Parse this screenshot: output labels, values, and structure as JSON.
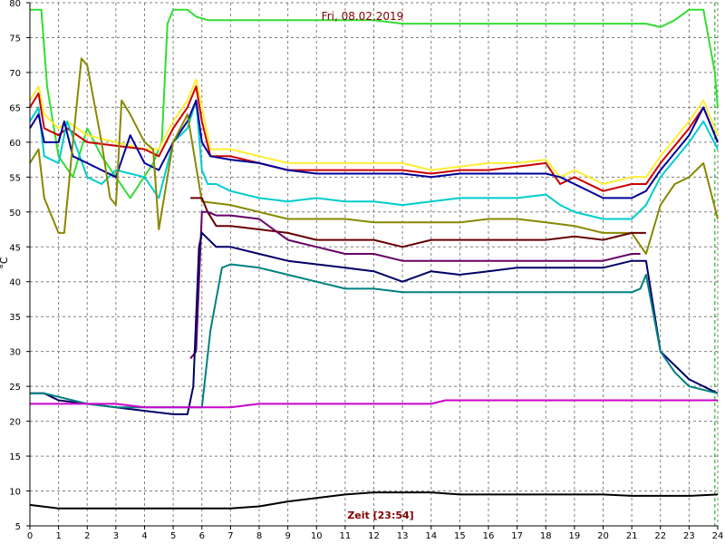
{
  "chart_data": {
    "type": "line",
    "title": "Fri, 08.02.2019",
    "xlabel": "Zeit [23:54]",
    "ylabel": "°C",
    "xlim": [
      0,
      24
    ],
    "ylim": [
      5,
      80
    ],
    "x_ticks": [
      0,
      1,
      2,
      3,
      4,
      5,
      6,
      7,
      8,
      9,
      10,
      11,
      12,
      13,
      14,
      15,
      16,
      17,
      18,
      19,
      20,
      21,
      22,
      23,
      24
    ],
    "y_ticks": [
      5,
      10,
      15,
      20,
      25,
      30,
      35,
      40,
      45,
      50,
      55,
      60,
      65,
      70,
      75,
      80
    ],
    "grid": true,
    "background": "#ffffff",
    "grid_color": "#808080",
    "end_marker_x": 23.9,
    "series": [
      {
        "color": "#33dd33",
        "x": [
          0,
          0.4,
          0.6,
          1,
          1.5,
          2,
          2.5,
          3,
          3.5,
          4.3,
          4.6,
          4.8,
          5,
          5.5,
          5.8,
          6.2,
          7,
          8,
          9,
          10,
          11,
          12,
          13,
          14,
          15,
          16,
          17,
          18,
          19,
          20,
          21,
          21.5,
          22,
          22.5,
          23,
          23.5,
          23.9,
          24
        ],
        "y": [
          79,
          79,
          68,
          58,
          55,
          62,
          58,
          55,
          52,
          57,
          60,
          77,
          79,
          79,
          78,
          77.5,
          77.5,
          77.5,
          77.5,
          77.5,
          77.5,
          77.5,
          77,
          77,
          77,
          77,
          77,
          77,
          77,
          77,
          77,
          77,
          76.5,
          77.5,
          79,
          79,
          70,
          65
        ]
      },
      {
        "color": "#ffee33",
        "x": [
          0,
          0.3,
          0.5,
          1,
          1.3,
          2,
          3,
          4,
          4.5,
          5,
          5.5,
          5.8,
          6,
          6.3,
          7,
          8,
          9,
          10,
          11,
          12,
          13,
          14,
          15,
          16,
          17,
          18,
          18.5,
          19,
          20,
          21,
          21.5,
          22,
          23,
          23.5,
          24
        ],
        "y": [
          66,
          68,
          64,
          62,
          63,
          61,
          60,
          59,
          59,
          63,
          66,
          69,
          65,
          59,
          59,
          58,
          57,
          57,
          57,
          57,
          57,
          56,
          56.5,
          57,
          57,
          57.5,
          55,
          56,
          54,
          55,
          55,
          58,
          63,
          66,
          61
        ]
      },
      {
        "color": "#cc0000",
        "x": [
          0,
          0.3,
          0.5,
          1,
          1.3,
          2,
          3,
          4,
          4.5,
          5,
          5.5,
          5.8,
          6,
          6.3,
          7,
          8,
          9,
          10,
          11,
          12,
          13,
          14,
          15,
          16,
          17,
          18,
          18.5,
          19,
          20,
          21,
          21.5,
          22,
          23,
          23.5,
          24
        ],
        "y": [
          65,
          67,
          62,
          61,
          62,
          60,
          59.5,
          59,
          58,
          62,
          65,
          68,
          63,
          58,
          58,
          57,
          56,
          56,
          56,
          56,
          56,
          55.5,
          56,
          56,
          56.5,
          57,
          54,
          55,
          53,
          54,
          54,
          57,
          62,
          65,
          60
        ]
      },
      {
        "color": "#00cccc",
        "x": [
          0,
          0.3,
          0.5,
          1,
          1.3,
          2,
          2.5,
          3,
          4,
          4.5,
          5,
          5.5,
          5.8,
          6,
          6.2,
          6.5,
          7,
          8,
          9,
          10,
          11,
          12,
          13,
          14,
          15,
          16,
          17,
          18,
          18.5,
          19,
          20,
          21,
          21.5,
          22,
          23,
          23.5,
          24
        ],
        "y": [
          63,
          65,
          58,
          57,
          63,
          55,
          54,
          56,
          55,
          52,
          60,
          62,
          66,
          56,
          54,
          54,
          53,
          52,
          51.5,
          52,
          51.5,
          51.5,
          51,
          51.5,
          52,
          52,
          52,
          52.5,
          51,
          50,
          49,
          49,
          51,
          55,
          60,
          63,
          59
        ]
      },
      {
        "color": "#000099",
        "x": [
          0,
          0.3,
          0.5,
          1,
          1.2,
          1.5,
          2,
          2.5,
          3,
          3.5,
          4,
          4.5,
          5,
          5.5,
          5.8,
          6,
          6.3,
          7,
          8,
          9,
          10,
          11,
          12,
          13,
          14,
          15,
          16,
          17,
          18,
          18.5,
          19,
          20,
          21,
          21.5,
          22,
          23,
          23.5,
          24
        ],
        "y": [
          62,
          64,
          60,
          60,
          63,
          58,
          57,
          56,
          55,
          61,
          57,
          56,
          60,
          63,
          66,
          60,
          58,
          57.5,
          57,
          56,
          55.5,
          55.5,
          55.5,
          55.5,
          55,
          55.5,
          55.5,
          55.5,
          55.5,
          55,
          54,
          52,
          52,
          53,
          56,
          61,
          65,
          60
        ]
      },
      {
        "color": "#888800",
        "x": [
          0,
          0.3,
          0.5,
          1,
          1.2,
          1.5,
          1.8,
          2,
          2.5,
          2.8,
          3,
          3.2,
          3.5,
          4,
          4.3,
          4.5,
          5,
          5.5,
          6,
          7,
          8,
          9,
          10,
          11,
          12,
          13,
          14,
          15,
          16,
          17,
          18,
          19,
          20,
          21,
          21.5,
          22,
          22.5,
          23,
          23.5,
          24
        ],
        "y": [
          57,
          59,
          52,
          47,
          47,
          60,
          72,
          71,
          60,
          52,
          51,
          66,
          64,
          60,
          59,
          47.5,
          60,
          64,
          51.5,
          51,
          50,
          49,
          49,
          49,
          48.5,
          48.5,
          48.5,
          48.5,
          49,
          49,
          48.5,
          48,
          47,
          47,
          44,
          51,
          54,
          55,
          57,
          49
        ]
      },
      {
        "color": "#660000",
        "x": [
          5.6,
          6,
          6.2,
          6.5,
          7,
          8,
          9,
          10,
          11,
          12,
          13,
          14,
          15,
          16,
          17,
          18,
          19,
          20,
          21,
          21.5
        ],
        "y": [
          52,
          52,
          50,
          48,
          48,
          47.5,
          47,
          46,
          46,
          46,
          45,
          46,
          46,
          46,
          46,
          46,
          46.5,
          46,
          47,
          47
        ]
      },
      {
        "color": "#660066",
        "x": [
          5.6,
          5.8,
          6,
          6.2,
          6.5,
          7,
          8,
          9,
          10,
          11,
          12,
          13,
          14,
          15,
          16,
          17,
          18,
          19,
          20,
          21,
          21.3
        ],
        "y": [
          29,
          30,
          50,
          50,
          49.5,
          49.5,
          49,
          46,
          45,
          44,
          44,
          43,
          43,
          43,
          43,
          43,
          43,
          43,
          43,
          44,
          44
        ]
      },
      {
        "color": "#000066",
        "x": [
          0,
          0.5,
          1,
          2,
          3,
          4,
          5,
          5.5,
          5.7,
          5.9,
          6,
          6.5,
          7,
          8,
          9,
          10,
          11,
          12,
          13,
          14,
          15,
          16,
          17,
          18,
          19,
          20,
          21,
          21.5,
          22,
          23,
          24
        ],
        "y": [
          24,
          24,
          23,
          22.5,
          22,
          21.5,
          21,
          21,
          25,
          45,
          47,
          45,
          45,
          44,
          43,
          42.5,
          42,
          41.5,
          40,
          41.5,
          41,
          41.5,
          42,
          42,
          42,
          42,
          43,
          43,
          30,
          26,
          24
        ]
      },
      {
        "color": "#008080",
        "x": [
          0,
          0.5,
          1,
          2,
          3,
          4,
          5,
          5.5,
          5.8,
          6,
          6.3,
          6.7,
          7,
          8,
          9,
          10,
          11,
          12,
          13,
          14,
          15,
          16,
          17,
          18,
          19,
          20,
          21,
          21.3,
          21.5,
          22,
          22.5,
          23,
          24
        ],
        "y": [
          24,
          24,
          23.5,
          22.5,
          22,
          22,
          22,
          22,
          22,
          22,
          33,
          42,
          42.5,
          42,
          41,
          40,
          39,
          39,
          38.5,
          38.5,
          38.5,
          38.5,
          38.5,
          38.5,
          38.5,
          38.5,
          38.5,
          39,
          41,
          30,
          27,
          25,
          24
        ]
      },
      {
        "color": "#cc00cc",
        "x": [
          0,
          1,
          2,
          3,
          4,
          5,
          6,
          7,
          8,
          9,
          10,
          11,
          12,
          13,
          14,
          14.5,
          15,
          16,
          17,
          18,
          19,
          20,
          21,
          22,
          23,
          24
        ],
        "y": [
          22.5,
          22.5,
          22.5,
          22.5,
          22,
          22,
          22,
          22,
          22.5,
          22.5,
          22.5,
          22.5,
          22.5,
          22.5,
          22.5,
          23,
          23,
          23,
          23,
          23,
          23,
          23,
          23,
          23,
          23,
          23
        ]
      },
      {
        "color": "#000000",
        "x": [
          0,
          1,
          2,
          3,
          4,
          5,
          6,
          7,
          8,
          9,
          10,
          11,
          12,
          13,
          14,
          15,
          16,
          17,
          18,
          19,
          20,
          21,
          22,
          23,
          24
        ],
        "y": [
          8,
          7.5,
          7.5,
          7.5,
          7.5,
          7.5,
          7.5,
          7.5,
          7.8,
          8.5,
          9,
          9.5,
          9.8,
          9.8,
          9.8,
          9.5,
          9.5,
          9.5,
          9.5,
          9.5,
          9.5,
          9.3,
          9.3,
          9.3,
          9.5
        ]
      }
    ]
  }
}
